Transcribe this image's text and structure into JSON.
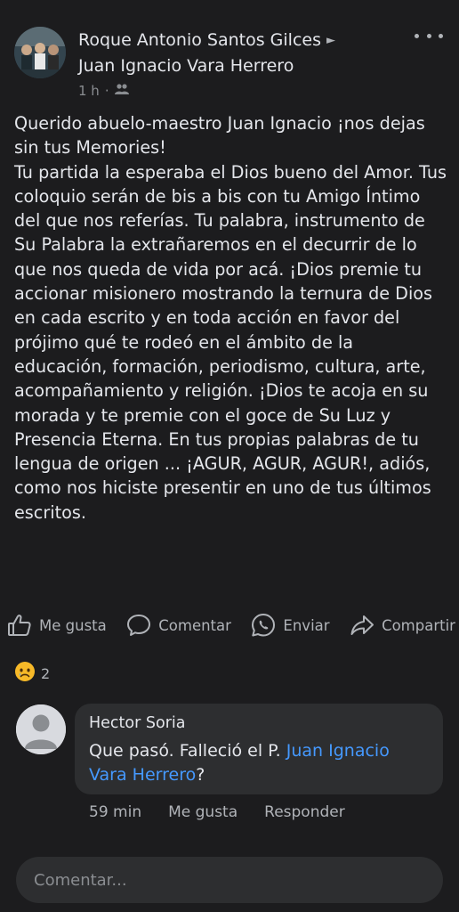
{
  "post": {
    "author": "Roque Antonio Santos Gilces",
    "arrow": "►",
    "target": "Juan Ignacio Vara Herrero",
    "time": "1 h",
    "dot": "·",
    "audience_icon": "friends-icon",
    "more_icon": "more-options-icon",
    "text": "Querido abuelo-maestro Juan Ignacio ¡nos dejas sin tus Memories!\nTu partida la esperaba el Dios bueno del Amor. Tus coloquio serán de bis a bis con tu Amigo Íntimo del que nos referías. Tu palabra, instrumento de Su Palabra la extrañaremos en el decurrir de lo que nos queda de vida por acá. ¡Dios premie tu accionar misionero mostrando la ternura de Dios en cada escrito y en toda acción en favor del prójimo qué te rodeó en el ámbito de la educación, formación, periodismo, cultura, arte, acompañamiento y religión. ¡Dios te acoja en su morada y te premie con el goce de Su Luz y Presencia Eterna. En tus propias palabras de tu lengua de origen ... ¡AGUR, AGUR, AGUR!, adiós, como nos hiciste  presentir en uno de tus últimos escritos."
  },
  "actions": {
    "like": "Me gusta",
    "comment": "Comentar",
    "send": "Enviar",
    "share": "Compartir"
  },
  "reactions": {
    "emoji": "sad-emoji",
    "count": "2"
  },
  "comment": {
    "author": "Hector Soria",
    "text_before": "Que pasó. Falleció el P. ",
    "mention": "Juan Ignacio Vara Herrero",
    "text_after": "?",
    "time": "59 min",
    "like": "Me gusta",
    "reply": "Responder"
  },
  "composer": {
    "placeholder": "Comentar..."
  },
  "colors": {
    "background": "#1c1c1e",
    "bubble": "#2d2e30",
    "mention": "#4599ff",
    "text": "#e4e6eb",
    "muted": "#b0b3b8"
  }
}
